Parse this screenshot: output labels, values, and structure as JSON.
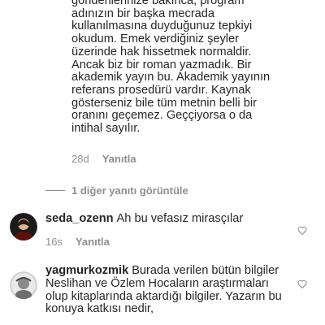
{
  "top_reply": {
    "text": "gönderilerinize bakınca, program\nadınızın bir başka mecrada\nkullanılmasına duyduğunuz tepkiyi\nokudum. Emek verdiğiniz şeyler\nüzerinde hak hissetmek normaldir.\nAncak biz bir roman yazmadık. Bir\nakademik yayın bu. Akademik yayının\nreferans prosedürü vardır. Kaynak\ngösterseniz bile tüm metnin belli bir\noranını geçemez. Geççiyorsa o da\nintihal sayılır.",
    "time": "28d",
    "reply_label": "Yanıtla"
  },
  "view_replies": {
    "label": "1 diğer yanıtı görüntüle"
  },
  "comments": [
    {
      "username": "seda_ozenn",
      "text": "Ah bu vefasız mirasçılar",
      "time": "16s",
      "reply_label": "Yanıtla"
    },
    {
      "username": "yagmurkozmik",
      "text": "Burada verilen bütün bilgiler Neslihan ve Özlem Hocaların araştırmaları olup kitaplarında aktardığı bilgiler. Yazarın bu konuya katkısı nedir,",
      "time": "",
      "reply_label": ""
    }
  ],
  "icons": {
    "like": "heart-icon"
  },
  "colors": {
    "text": "#262626",
    "muted": "#8e8e8e",
    "background": "#ffffff"
  }
}
